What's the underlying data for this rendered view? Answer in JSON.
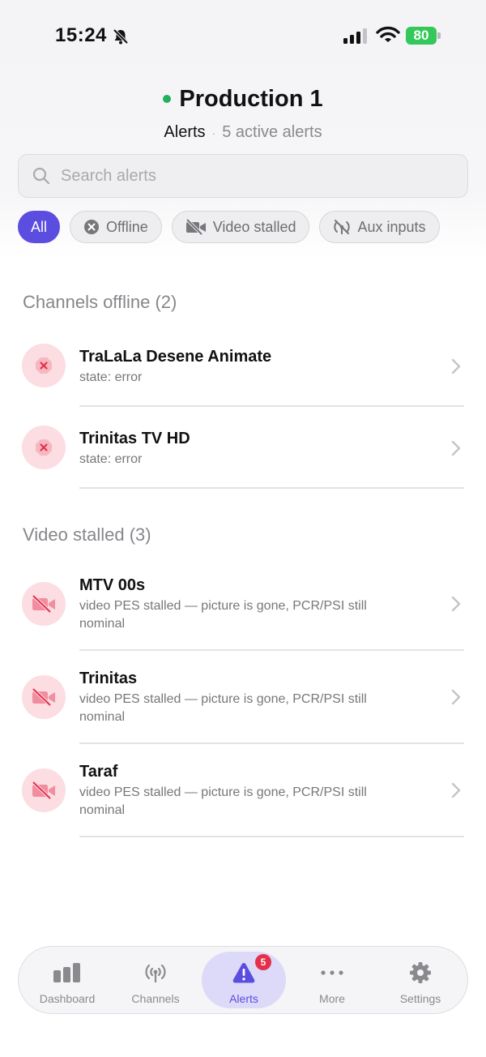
{
  "status_bar": {
    "time": "15:24",
    "battery": "80"
  },
  "header": {
    "title": "Production 1",
    "subtitle_active": "Alerts",
    "subtitle_separator": "·",
    "subtitle_count": "5 active alerts"
  },
  "search": {
    "placeholder": "Search alerts",
    "value": ""
  },
  "filters": [
    {
      "label": "All",
      "active": true
    },
    {
      "label": "Offline",
      "icon": "x-circle-icon"
    },
    {
      "label": "Video stalled",
      "icon": "video-off-icon"
    },
    {
      "label": "Aux inputs",
      "icon": "antenna-off-icon"
    }
  ],
  "sections": [
    {
      "title": "Channels offline (2)",
      "items": [
        {
          "name": "TraLaLa Desene Animate",
          "desc": "state: error",
          "icon": "error-octagon-icon"
        },
        {
          "name": "Trinitas TV HD",
          "desc": "state: error",
          "icon": "error-octagon-icon"
        }
      ]
    },
    {
      "title": "Video stalled (3)",
      "items": [
        {
          "name": "MTV 00s",
          "desc": "video PES stalled — picture is gone, PCR/PSI still nominal",
          "icon": "video-off-icon"
        },
        {
          "name": "Trinitas",
          "desc": "video PES stalled — picture is gone, PCR/PSI still nominal",
          "icon": "video-off-icon"
        },
        {
          "name": "Taraf",
          "desc": "video PES stalled — picture is gone, PCR/PSI still nominal",
          "icon": "video-off-icon"
        }
      ]
    }
  ],
  "tabbar": {
    "tabs": [
      {
        "label": "Dashboard",
        "icon": "bar-chart-icon"
      },
      {
        "label": "Channels",
        "icon": "antenna-icon"
      },
      {
        "label": "Alerts",
        "icon": "alert-triangle-icon",
        "badge": "5",
        "active": true
      },
      {
        "label": "More",
        "icon": "more-dots-icon"
      },
      {
        "label": "Settings",
        "icon": "gear-icon"
      }
    ]
  },
  "colors": {
    "accent": "#5b4de0",
    "live": "#22b05b",
    "error_bg": "#fbdde2",
    "error": "#e5304a",
    "battery": "#34c759"
  }
}
